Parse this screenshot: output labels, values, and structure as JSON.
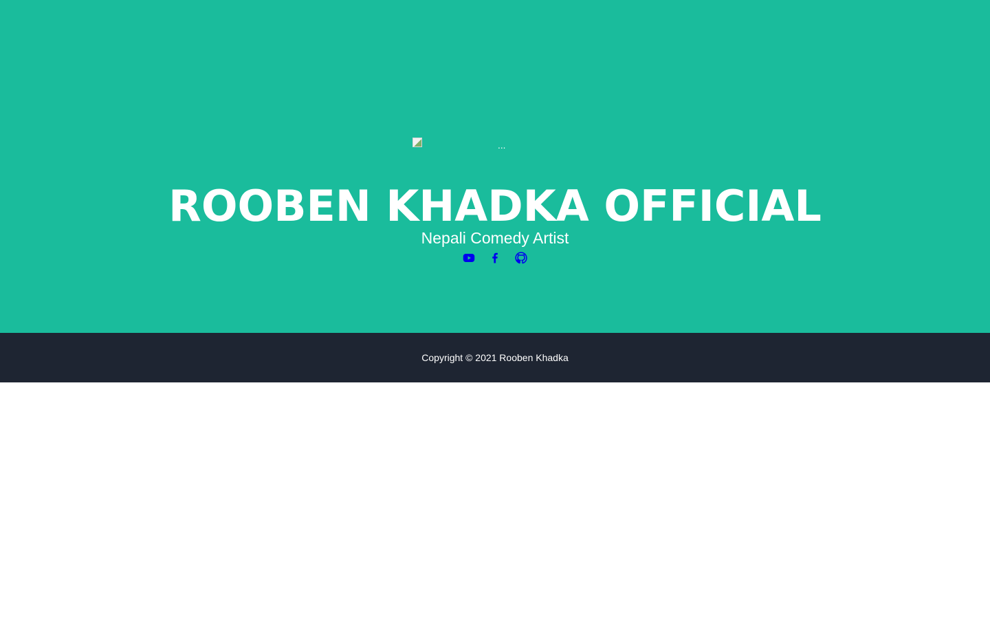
{
  "header": {
    "avatar_alt": "...",
    "title": "ROOBEN KHADKA OFFICIAL",
    "subtitle": "Nepali Comedy Artist",
    "social_links": [
      {
        "name": "youtube",
        "icon": "youtube-icon"
      },
      {
        "name": "facebook",
        "icon": "facebook-icon"
      },
      {
        "name": "github",
        "icon": "github-icon"
      }
    ]
  },
  "footer": {
    "copyright": "Copyright © 2021 Rooben Khadka"
  },
  "colors": {
    "hero_background": "#1abc9c",
    "footer_background": "#1e2532",
    "text": "#ffffff",
    "link": "#0000ee"
  }
}
